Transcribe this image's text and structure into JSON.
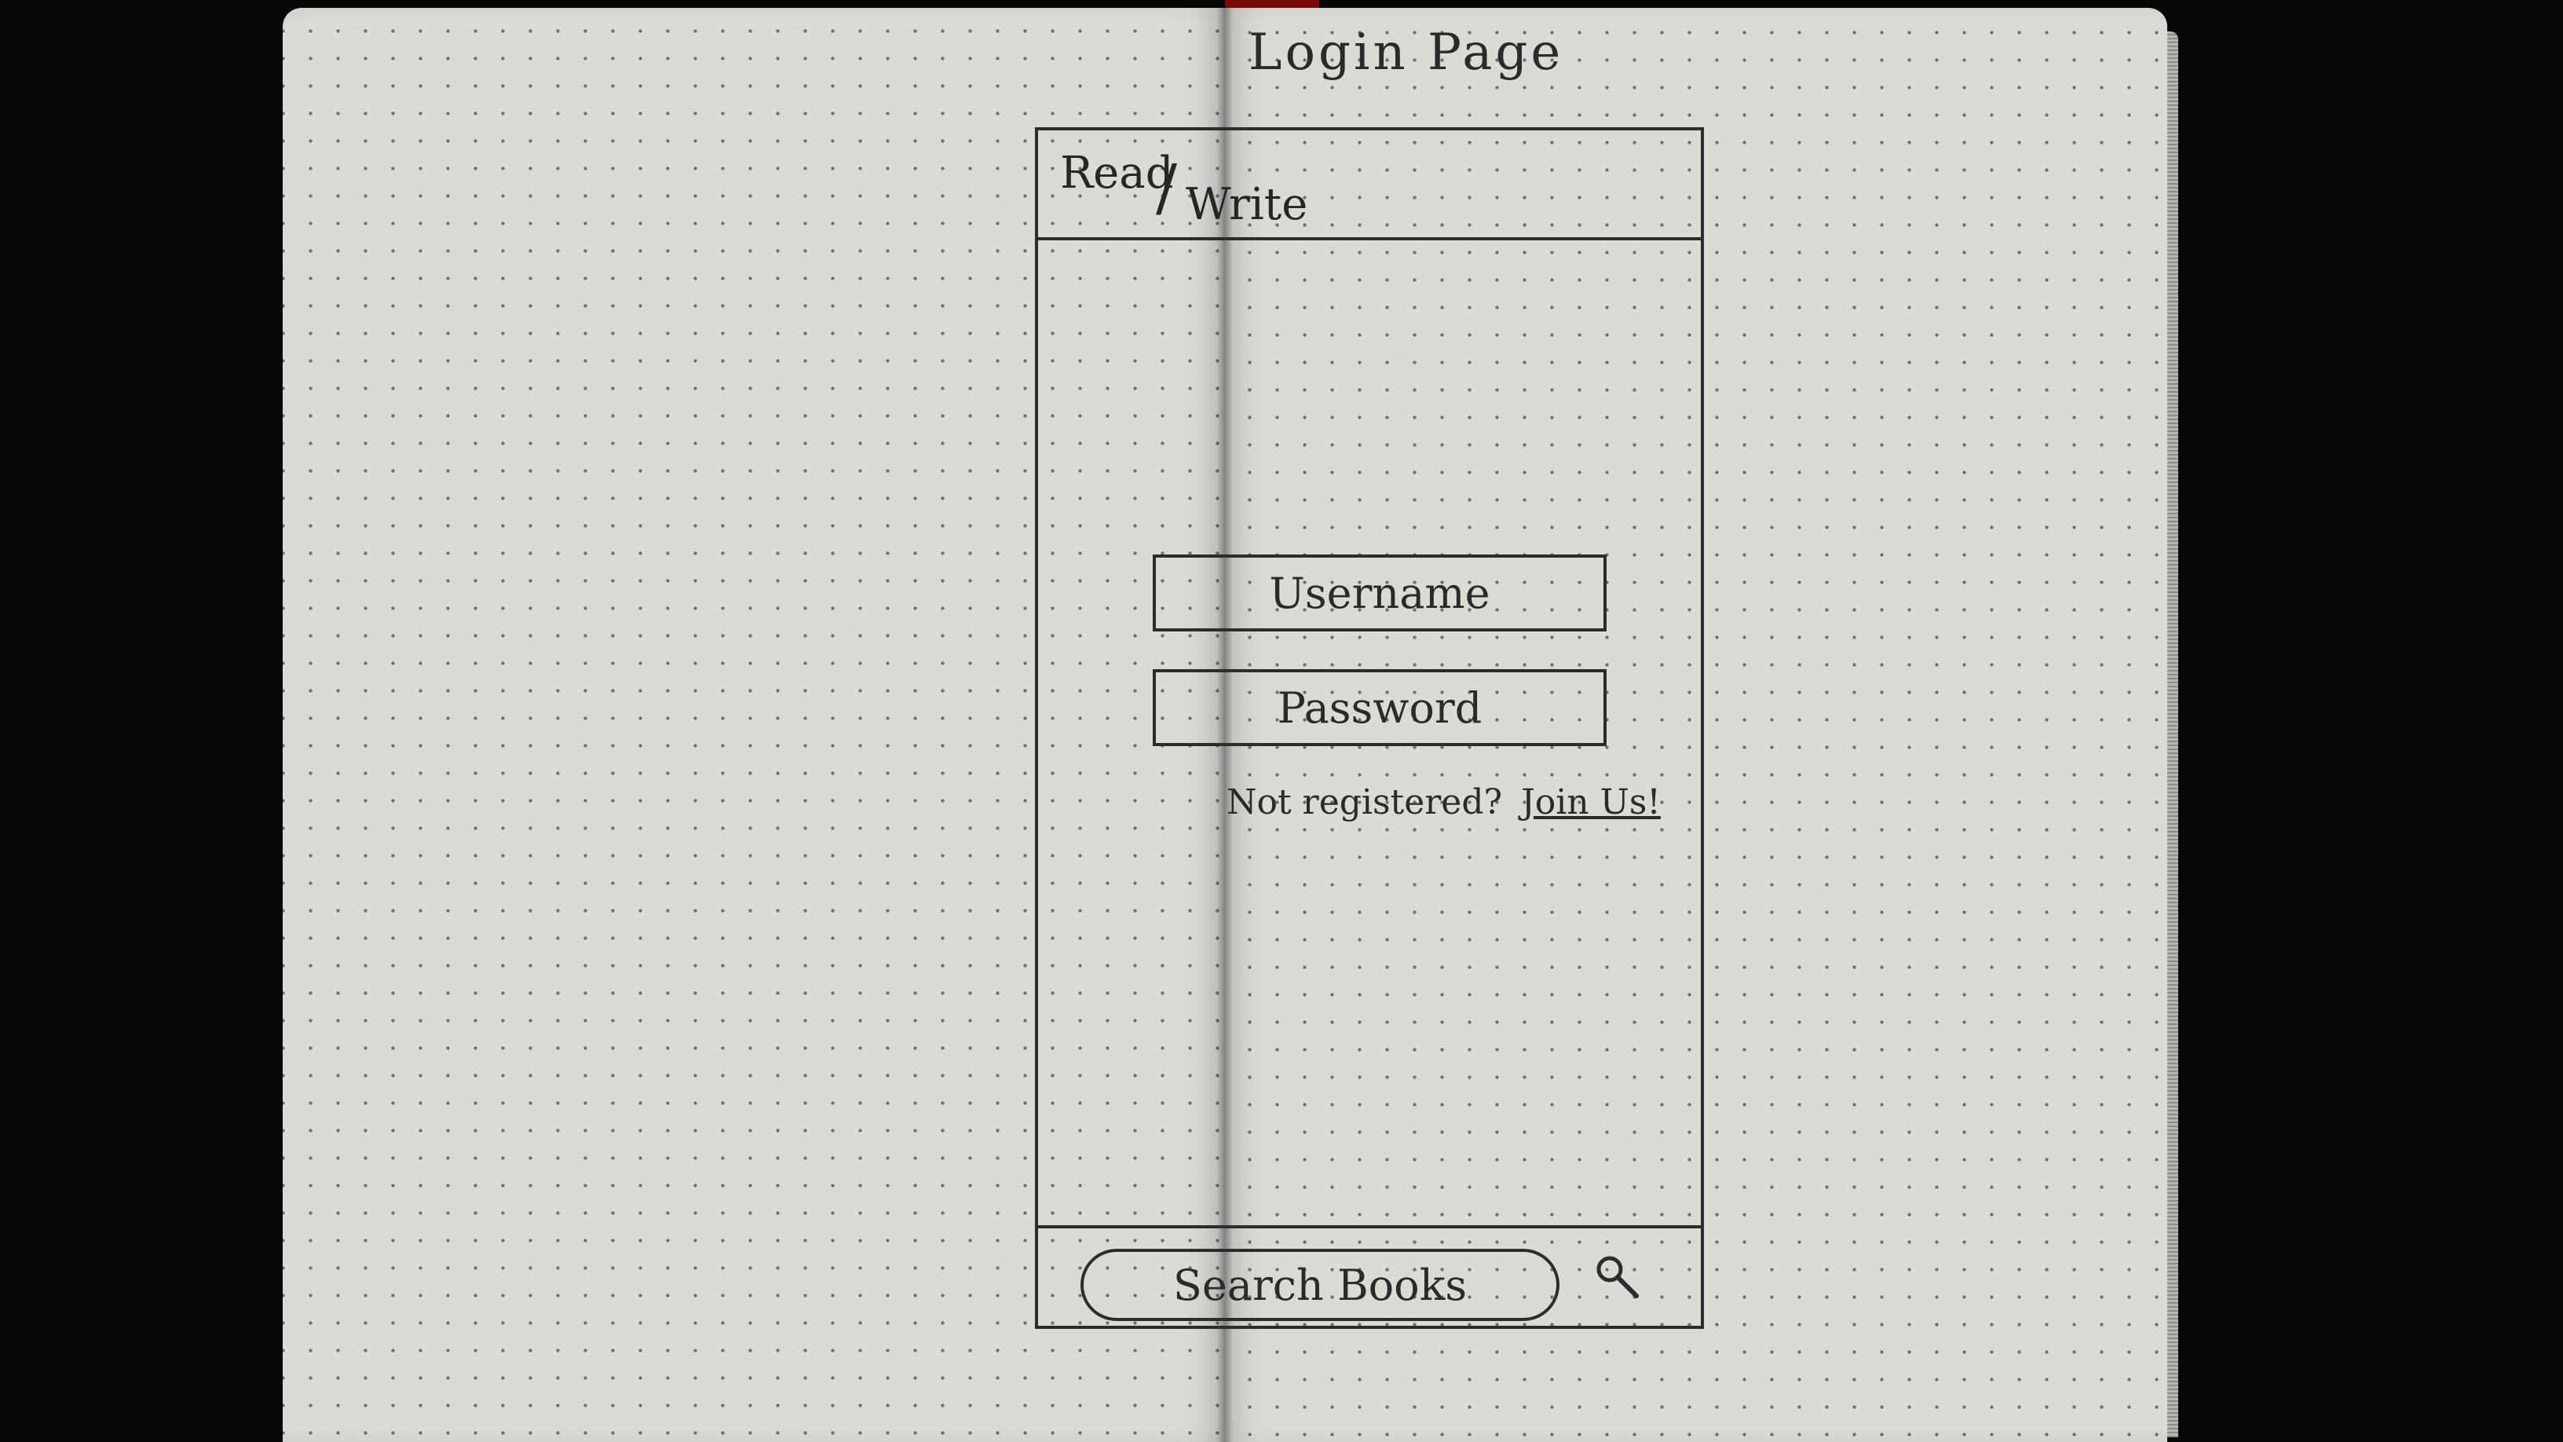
{
  "sketch": {
    "title": "Login Page"
  },
  "app": {
    "brand_read": "Read",
    "brand_slash": "/",
    "brand_write": "Write"
  },
  "login": {
    "username_placeholder": "Username",
    "password_placeholder": "Password",
    "register_prompt": "Not registered?",
    "join_link": "Join Us!"
  },
  "footer": {
    "search_placeholder": "Search Books",
    "search_icon": "search-icon"
  },
  "colors": {
    "paper": "#dcdad4",
    "ink": "#2c2c2c",
    "background": "#060606"
  }
}
